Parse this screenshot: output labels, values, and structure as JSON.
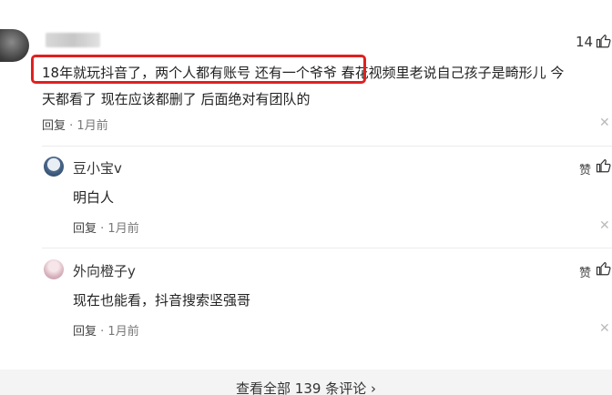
{
  "main_comment": {
    "like_count": "14",
    "text_line1": "18年就玩抖音了，两个人都有账号 还有一个爷爷 春花视频里老说自己孩子是畸形儿 今",
    "text_line2": "天都看了 现在应该都删了 后面绝对有团队的",
    "reply_label": "回复",
    "time": "1月前"
  },
  "replies": [
    {
      "username": "豆小宝v",
      "like_label": "赞",
      "text": "明白人",
      "reply_label": "回复",
      "time": "1月前"
    },
    {
      "username": "外向橙子y",
      "like_label": "赞",
      "text": "现在也能看，抖音搜索坚强哥",
      "reply_label": "回复",
      "time": "1月前"
    }
  ],
  "footer": {
    "view_all": "查看全部 139 条评论 ›"
  },
  "colors": {
    "highlight": "#e02020"
  }
}
